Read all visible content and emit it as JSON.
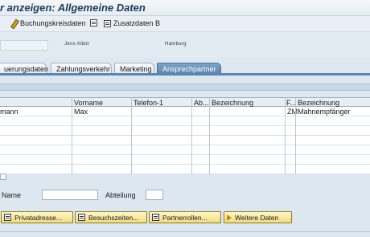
{
  "window": {
    "title": "r anzeigen: Allgemeine Daten"
  },
  "toolbar": {
    "items": [
      {
        "label": "Buchungskreisdaten",
        "icon": "edit-pen-icon"
      },
      {
        "label": "",
        "icon": "document-icon"
      },
      {
        "label": "Zusatzdaten B",
        "icon": "document-icon"
      }
    ]
  },
  "header": {
    "vendor_name": "Jens Albot",
    "city": "Hamburg"
  },
  "tabs": [
    {
      "label": "uerungsdaten"
    },
    {
      "label": "Zahlungsverkehr"
    },
    {
      "label": "Marketing"
    },
    {
      "label": "Ansprechpartner"
    }
  ],
  "table": {
    "headers": [
      "Vorname",
      "Telefon-1",
      "Ab...",
      "Bezeichnung",
      "F...",
      "Bezeichnung"
    ],
    "rows": [
      {
        "name": "mann",
        "vorname": "Max",
        "telefon": "",
        "ab": "",
        "bez1": "",
        "f": "ZM",
        "bez2": "Mahnempfänger"
      }
    ]
  },
  "form": {
    "name_label": "Name",
    "abteilung_label": "Abteilung"
  },
  "buttons": [
    {
      "label": "Privatadresse...",
      "icon": "document-icon"
    },
    {
      "label": "Besuchszeiten...",
      "icon": "calendar-icon"
    },
    {
      "label": "Partnerrollen...",
      "icon": "partner-icon"
    },
    {
      "label": "Weitere Daten",
      "icon": "arrow-right-icon"
    }
  ]
}
